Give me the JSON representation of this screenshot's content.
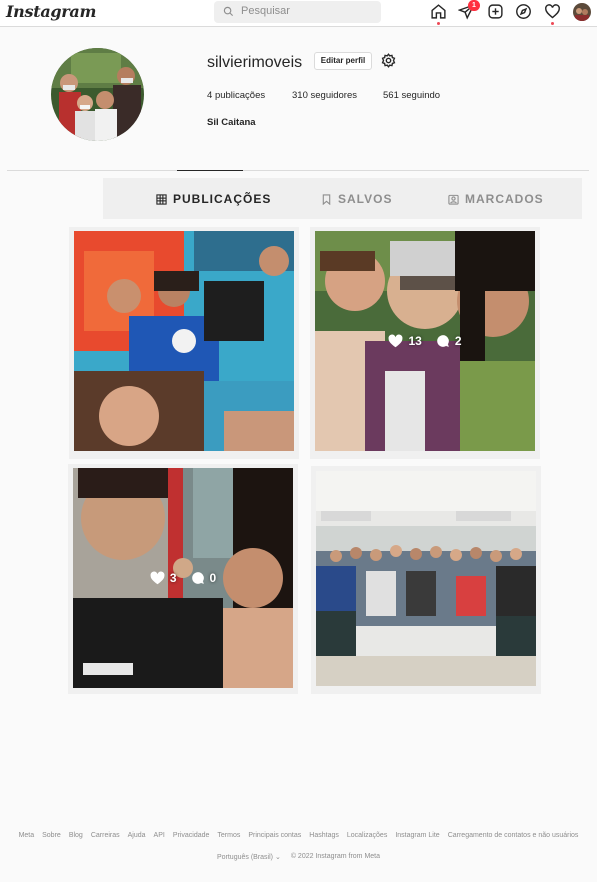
{
  "nav": {
    "logo": "Instagram",
    "search_placeholder": "Pesquisar",
    "notification_count": "1",
    "icons": [
      "home-icon",
      "direct-icon",
      "new-post-icon",
      "explore-icon",
      "activity-heart-icon",
      "profile-avatar"
    ]
  },
  "profile": {
    "username": "silvierimoveis",
    "edit_label": "Editar perfil",
    "posts_count": "4",
    "posts_label": "publicações",
    "followers_count": "310",
    "followers_label": "seguidores",
    "following_count": "561",
    "following_label": "seguindo",
    "full_name": "Sil Caitana"
  },
  "tabs": [
    {
      "label": "PUBLICAÇÕES",
      "icon": "grid-icon",
      "active": true
    },
    {
      "label": "SALVOS",
      "icon": "bookmark-icon",
      "active": false
    },
    {
      "label": "MARCADOS",
      "icon": "tagged-icon",
      "active": false
    }
  ],
  "posts": [
    {
      "likes": "",
      "comments": ""
    },
    {
      "likes": "13",
      "comments": "2"
    },
    {
      "likes": "3",
      "comments": "0"
    },
    {
      "likes": "",
      "comments": ""
    }
  ],
  "footer": {
    "links": [
      "Meta",
      "Sobre",
      "Blog",
      "Carreiras",
      "Ajuda",
      "API",
      "Privacidade",
      "Termos",
      "Principais contas",
      "Hashtags",
      "Localizações",
      "Instagram Lite",
      "Carregamento de contatos e não usuários"
    ],
    "language": "Português (Brasil)",
    "copyright": "© 2022 Instagram from Meta"
  },
  "colors": {
    "accent_red": "#ed4956",
    "border": "#dbdbdb",
    "muted_text": "#8e8e8e"
  }
}
